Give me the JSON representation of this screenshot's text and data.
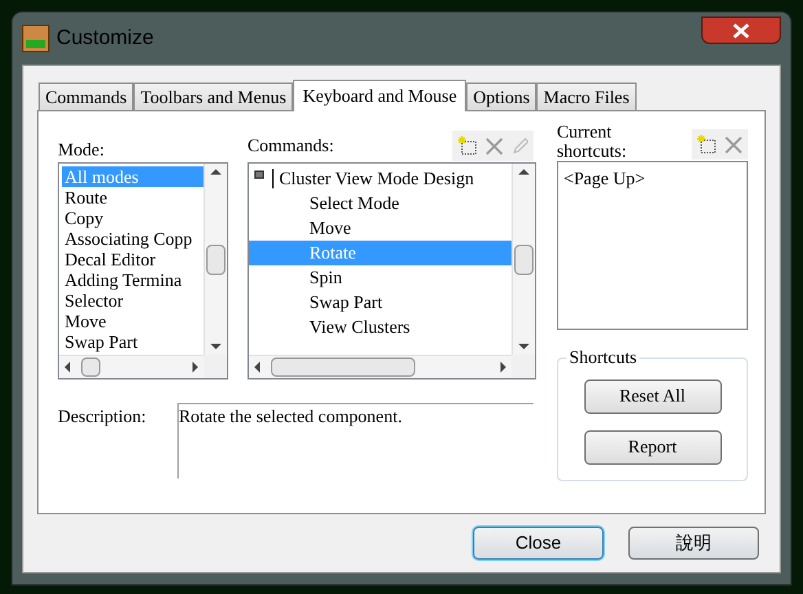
{
  "window": {
    "title": "Customize"
  },
  "tabs": [
    {
      "label": "Commands",
      "selected": false
    },
    {
      "label": "Toolbars and Menus",
      "selected": false
    },
    {
      "label": "Keyboard and Mouse",
      "selected": true
    },
    {
      "label": "Options",
      "selected": false
    },
    {
      "label": "Macro Files",
      "selected": false
    }
  ],
  "mode": {
    "label": "Mode:",
    "items": [
      {
        "label": "All modes",
        "selected": true
      },
      {
        "label": "Route",
        "selected": false
      },
      {
        "label": "Copy",
        "selected": false
      },
      {
        "label": "Associating Copp",
        "selected": false
      },
      {
        "label": "Decal Editor",
        "selected": false
      },
      {
        "label": "Adding Termina",
        "selected": false
      },
      {
        "label": "Selector",
        "selected": false
      },
      {
        "label": "Move",
        "selected": false
      },
      {
        "label": "Swap Part",
        "selected": false
      }
    ]
  },
  "commands": {
    "label": "Commands:",
    "items": [
      {
        "label": "Cluster View Mode Design",
        "selected": false,
        "children": [
          {
            "label": "Select Mode",
            "selected": false
          },
          {
            "label": "Move",
            "selected": false
          },
          {
            "label": "Rotate",
            "selected": true
          },
          {
            "label": "Spin",
            "selected": false
          },
          {
            "label": "Swap Part",
            "selected": false
          },
          {
            "label": "View Clusters",
            "selected": false
          }
        ]
      }
    ]
  },
  "shortcuts": {
    "label": "Current shortcuts:",
    "items": [
      "<Page Up>"
    ]
  },
  "shortcuts_group": {
    "title": "Shortcuts",
    "buttons": [
      "Reset All",
      "Report"
    ]
  },
  "description": {
    "label": "Description:",
    "value": "Rotate the selected component."
  },
  "footer_buttons": [
    {
      "label": "Close",
      "default": true
    },
    {
      "label": "說明",
      "default": false
    }
  ]
}
